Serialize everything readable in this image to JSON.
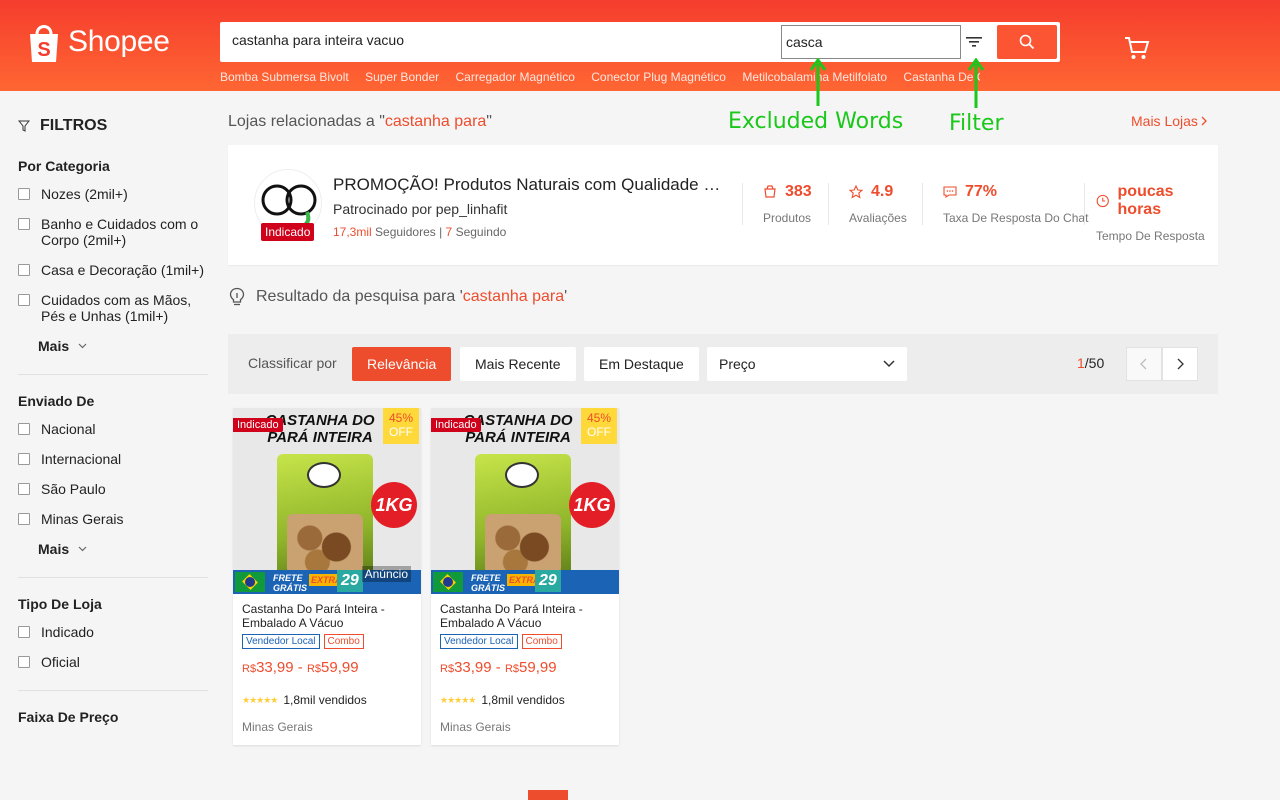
{
  "header": {
    "logo_text": "Shopee",
    "search_value": "castanha para inteira vacuo",
    "excluded_words_value": "casca",
    "hints": [
      "Bomba Submersa Bivolt",
      "Super Bonder",
      "Carregador Magnético",
      "Conector Plug Magnético",
      "Metilcobalamina Metilfolato",
      "Castanha De Caju"
    ]
  },
  "annotations": {
    "excluded": "Excluded Words",
    "filter": "Filter"
  },
  "sidebar": {
    "title": "FILTROS",
    "sections": [
      {
        "title": "Por Categoria",
        "items": [
          "Nozes (2mil+)",
          "Banho e Cuidados com o Corpo (2mil+)",
          "Casa e Decoração (1mil+)",
          "Cuidados com as Mãos, Pés e Unhas (1mil+)"
        ],
        "more": "Mais"
      },
      {
        "title": "Enviado De",
        "items": [
          "Nacional",
          "Internacional",
          "São Paulo",
          "Minas Gerais"
        ],
        "more": "Mais"
      },
      {
        "title": "Tipo De Loja",
        "items": [
          "Indicado",
          "Oficial"
        ]
      },
      {
        "title": "Faixa De Preço",
        "items": []
      }
    ]
  },
  "related": {
    "prefix": "Lojas relacionadas a \"",
    "query": "castanha para",
    "suffix": "\"",
    "more_link": "Mais Lojas"
  },
  "shop": {
    "badge": "Indicado",
    "name": "PROMOÇÃO! Produtos Naturais com Qualidade e Preço Baixo",
    "sponsor": "Patrocinado por pep_linhafit",
    "followers": "17,3mil",
    "followers_label": "Seguidores |",
    "following": "7",
    "following_label": "Seguindo",
    "stats": [
      {
        "value": "383",
        "label": "Produtos"
      },
      {
        "value": "4.9",
        "label": "Avaliações"
      },
      {
        "value": "77%",
        "label": "Taxa De Resposta Do Chat"
      },
      {
        "value": "poucas horas",
        "label": "Tempo De Resposta"
      }
    ]
  },
  "result": {
    "prefix": "Resultado da pesquisa para '",
    "query": "castanha para",
    "suffix": "'"
  },
  "sortbar": {
    "label": "Classificar por",
    "options": [
      "Relevância",
      "Mais Recente",
      "Em Destaque"
    ],
    "price_label": "Preço",
    "page_current": "1",
    "page_total": "/50"
  },
  "products": [
    {
      "tag": "Indicado",
      "off_pct": "45%",
      "off_label": "OFF",
      "img_title": "CASTANHA DO PARÁ INTEIRA",
      "kg": "1KG",
      "frete": "FRETE GRÁTIS",
      "extra": "EXTRA",
      "frete_num": "29",
      "ad_label": "Anúncio",
      "name": "Castanha Do Pará Inteira - Embalado A Vácuo",
      "chips": [
        "Vendedor Local",
        "Combo"
      ],
      "price_from": "33,99",
      "price_to": "59,99",
      "sold": "1,8mil vendidos",
      "location": "Minas Gerais"
    },
    {
      "tag": "Indicado",
      "off_pct": "45%",
      "off_label": "OFF",
      "img_title": "CASTANHA DO PARÁ INTEIRA",
      "kg": "1KG",
      "frete": "FRETE GRÁTIS",
      "extra": "EXTRA",
      "frete_num": "29",
      "ad_label": "",
      "name": "Castanha Do Pará Inteira - Embalado A Vácuo",
      "chips": [
        "Vendedor Local",
        "Combo"
      ],
      "price_from": "33,99",
      "price_to": "59,99",
      "sold": "1,8mil vendidos",
      "location": "Minas Gerais"
    }
  ],
  "currency": "R$",
  "colors": {
    "brand": "#ee4d2d",
    "annotation": "#1ac81a"
  }
}
